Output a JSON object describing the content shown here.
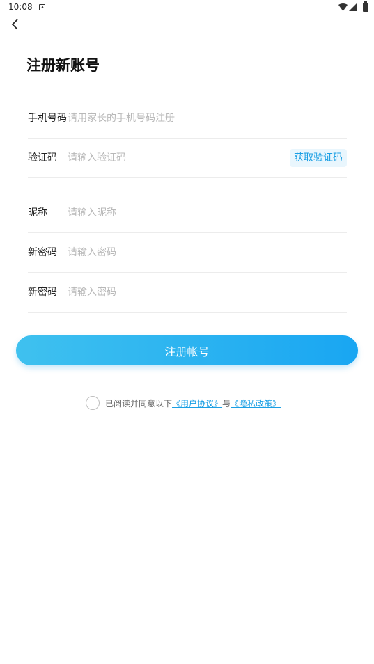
{
  "status_bar": {
    "time": "10:08"
  },
  "page": {
    "title": "注册新账号"
  },
  "form": {
    "phone": {
      "label": "手机号码",
      "placeholder": "请用家长的手机号码注册"
    },
    "code": {
      "label": "验证码",
      "placeholder": "请输入验证码",
      "button_label": "获取验证码"
    },
    "nickname": {
      "label": "昵称",
      "placeholder": "请输入昵称"
    },
    "password": {
      "label": "新密码",
      "placeholder": "请输入密码"
    },
    "password_confirm": {
      "label": "新密码",
      "placeholder": "请输入密码"
    }
  },
  "submit": {
    "label": "注册帐号"
  },
  "agreement": {
    "prefix": "已阅读并同意以下",
    "user_agreement": "《用户协议》",
    "connector": "与",
    "privacy_policy": "《隐私政策》"
  },
  "colors": {
    "accent": "#1a9fe4",
    "button_gradient_start": "#3fc1ef",
    "button_gradient_end": "#19a6f2"
  }
}
